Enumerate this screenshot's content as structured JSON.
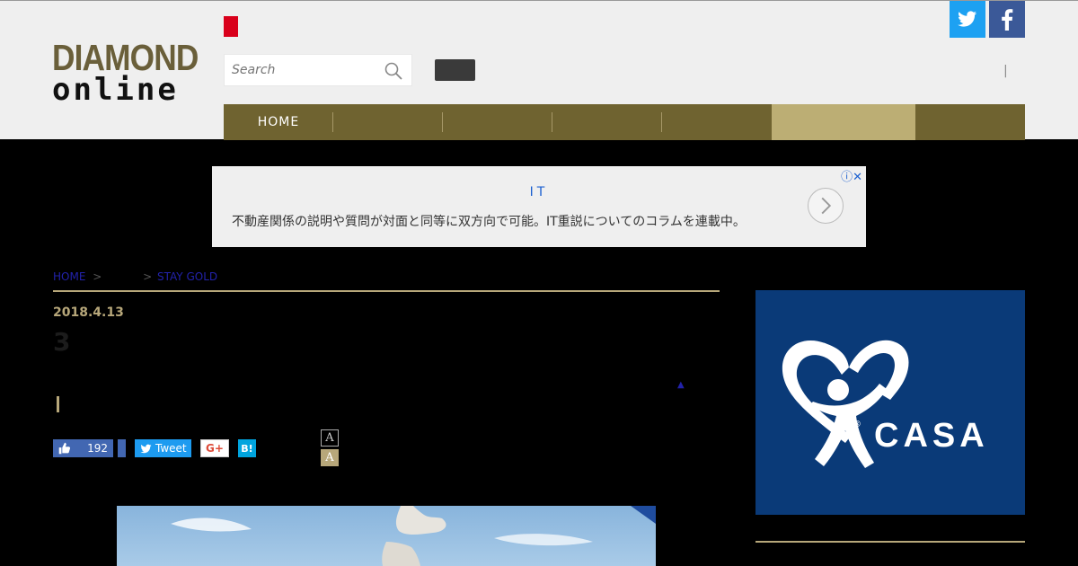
{
  "logo": {
    "line1": "DIAMOND",
    "line2": "online"
  },
  "search": {
    "placeholder": "Search"
  },
  "header": {
    "separator": "|"
  },
  "social": {
    "twitter": "twitter-icon",
    "facebook": "facebook-icon"
  },
  "nav": [
    {
      "label": "HOME",
      "active": false
    },
    {
      "label": "",
      "active": false
    },
    {
      "label": "",
      "active": false
    },
    {
      "label": "",
      "active": false
    },
    {
      "label": "",
      "active": false
    },
    {
      "label": "",
      "active": true
    },
    {
      "label": "",
      "active": false
    }
  ],
  "ad": {
    "headline": "IT",
    "text": "不動産関係の説明や質問が対面と同等に双方向で可能。IT重説についてのコラムを連載中。",
    "icons": "ⓘ✕"
  },
  "breadcrumb": {
    "home": "HOME",
    "sep1": ">",
    "sep2": ">",
    "current": "STAY GOLD"
  },
  "article": {
    "date": "2018.4.13",
    "title": "3"
  },
  "share": {
    "like_count": "192",
    "tweet": "Tweet",
    "gplus": "G+",
    "hatena": "B!"
  },
  "font_size": {
    "small": "A",
    "large": "A"
  },
  "sidebar_ad": {
    "brand": "CASA",
    "reg": "®"
  },
  "colors": {
    "accent_gold": "#b7a77a",
    "nav_bg": "#6f6330",
    "nav_active": "#bcae74"
  }
}
